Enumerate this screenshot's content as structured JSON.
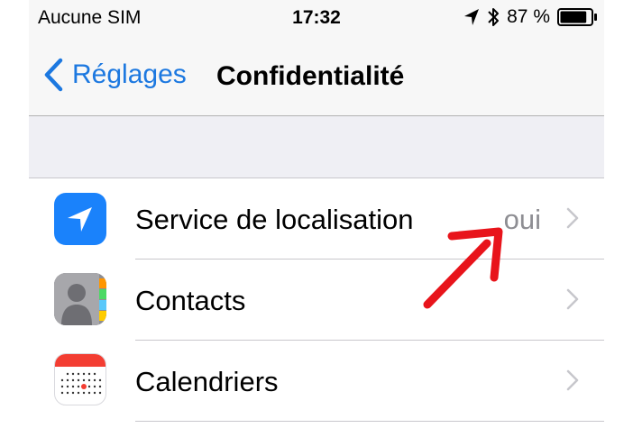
{
  "status_bar": {
    "carrier": "Aucune SIM",
    "time": "17:32",
    "battery": "87 %",
    "battery_level": 87
  },
  "nav": {
    "back_label": "Réglages",
    "title": "Confidentialité"
  },
  "rows": [
    {
      "label": "Service de localisation",
      "value": "oui",
      "icon": "location-arrow-icon"
    },
    {
      "label": "Contacts",
      "value": "",
      "icon": "contacts-icon"
    },
    {
      "label": "Calendriers",
      "value": "",
      "icon": "calendar-icon"
    }
  ],
  "colors": {
    "ios_blue": "#1c78e0",
    "location_icon_bg": "#1a82fb",
    "annotation_red": "#e8141b",
    "value_gray": "#8e8e93"
  }
}
